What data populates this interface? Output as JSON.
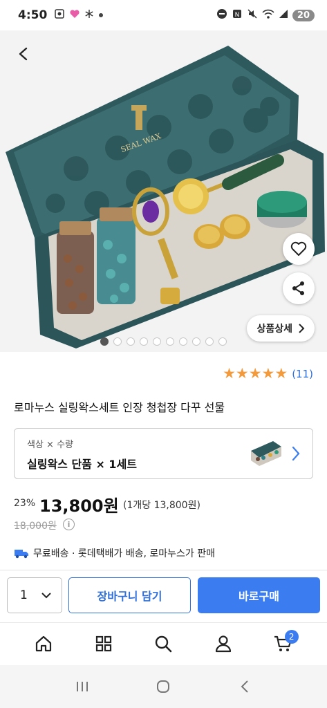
{
  "status_bar": {
    "time": "4:50",
    "battery": "20"
  },
  "product": {
    "title": "로마누스 실링왁스세트 인장 청첩장 다꾸 선물",
    "image_box_text": "SEAL WAX",
    "carousel": {
      "total": 10,
      "active": 1
    },
    "detail_button": "상품상세",
    "rating": {
      "stars": 5,
      "count_text": "(11)"
    }
  },
  "option": {
    "label": "색상 × 수량",
    "value": "실링왁스 단품 × 1세트"
  },
  "price": {
    "discount": "23%",
    "sale_price": "13,800원",
    "unit_price": "(1개당 13,800원)",
    "original_price": "18,000원",
    "info_icon_text": "i"
  },
  "shipping": {
    "text": "무료배송 · 롯데택배가 배송, 로마누스가 판매"
  },
  "actions": {
    "quantity": "1",
    "cart_button": "장바구니 담기",
    "buy_button": "바로구매"
  },
  "bottom_nav": {
    "items": [
      {
        "icon": "home-icon"
      },
      {
        "icon": "grid-icon"
      },
      {
        "icon": "search-icon"
      },
      {
        "icon": "profile-icon"
      },
      {
        "icon": "cart-icon"
      }
    ],
    "cart_badge": "2"
  },
  "colors": {
    "accent": "#3b7cf0",
    "link": "#2f6fd8",
    "star": "#f39a3c",
    "box_teal": "#2e5a5e"
  }
}
